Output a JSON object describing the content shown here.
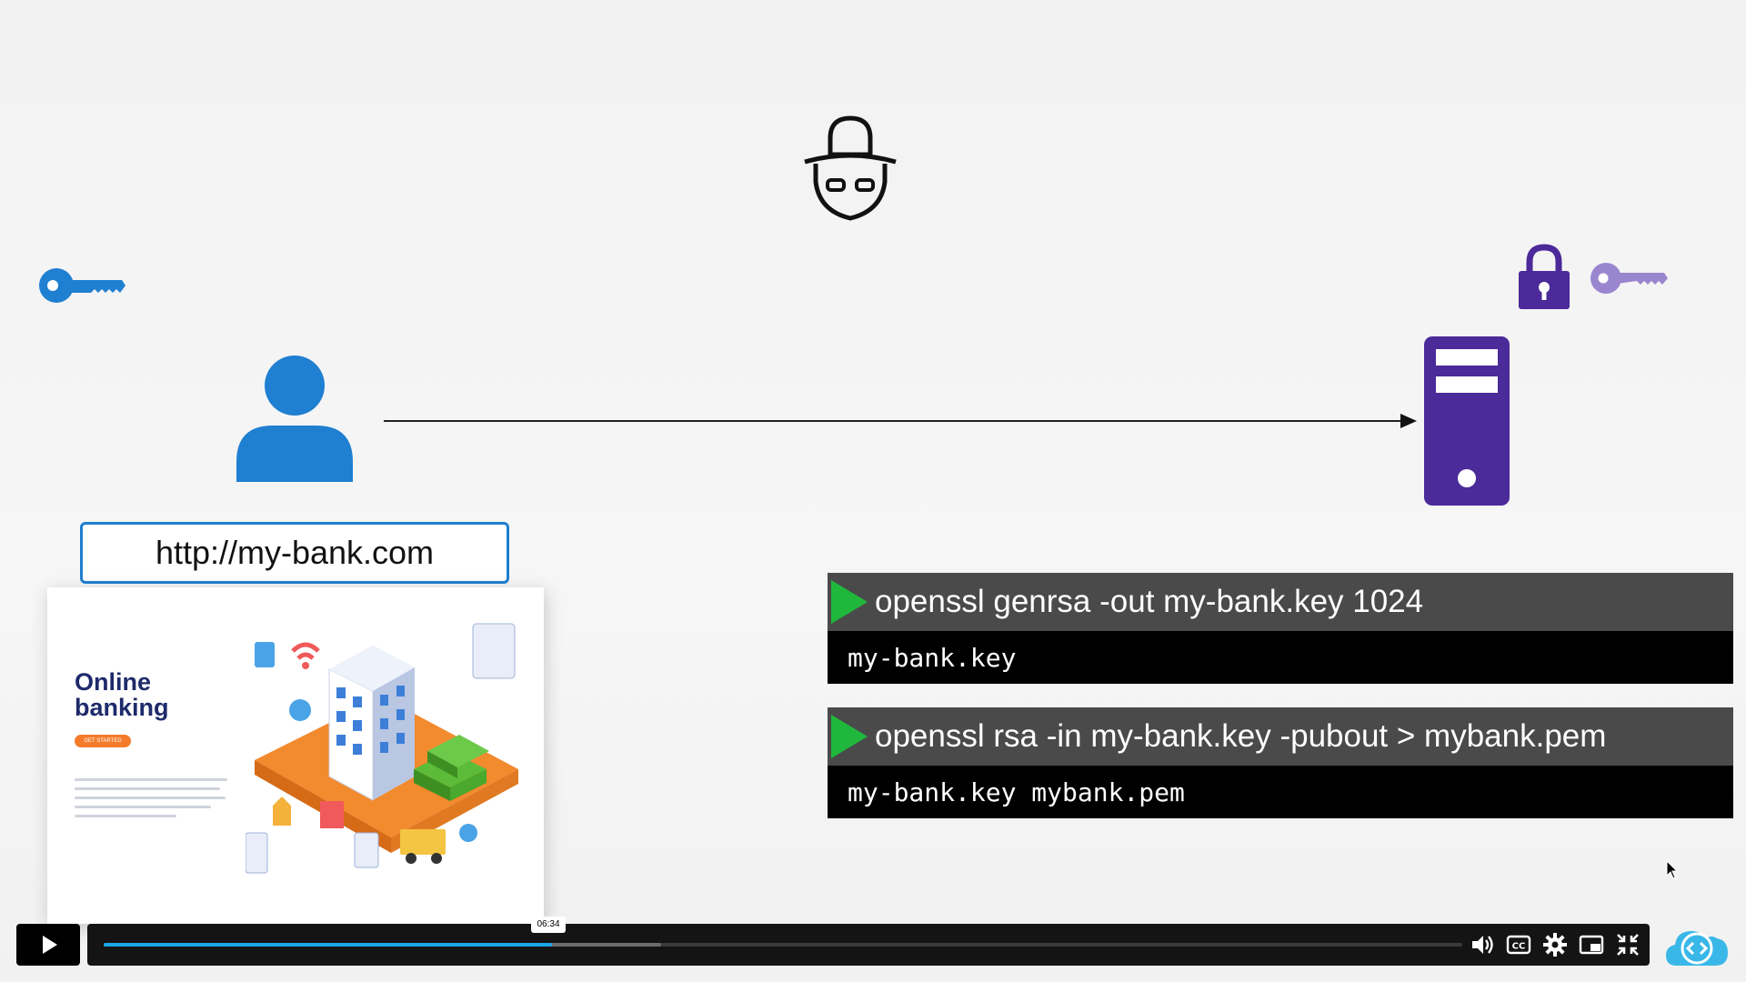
{
  "slide": {
    "url": "http://my-bank.com",
    "preview": {
      "title_line1": "Online",
      "title_line2": "banking",
      "button_label": "GET STARTED"
    },
    "terminals": [
      {
        "command": "openssl genrsa -out my-bank.key 1024",
        "output": "my-bank.key"
      },
      {
        "command": "openssl rsa -in my-bank.key -pubout > mybank.pem",
        "output": "my-bank.key mybank.pem"
      }
    ],
    "icons": {
      "hacker": "hacker-icon",
      "client_key": "key-icon",
      "server_key": "key-icon",
      "padlock": "padlock-icon",
      "user": "user-icon",
      "server": "server-icon"
    },
    "colors": {
      "client_key": "#1f7fd1",
      "user": "#1f7fd1",
      "server": "#4b2a99",
      "server_key": "#9a86cf",
      "terminal_prompt": "#1fb83c",
      "progress": "#1aa7e8"
    }
  },
  "player": {
    "current_time": "06:34",
    "progress_fraction": 0.33,
    "buffered_fraction": 0.33,
    "controls": [
      "play-icon",
      "volume-icon",
      "captions-icon",
      "settings-icon",
      "picture-in-picture-icon",
      "exit-fullscreen-icon"
    ]
  }
}
